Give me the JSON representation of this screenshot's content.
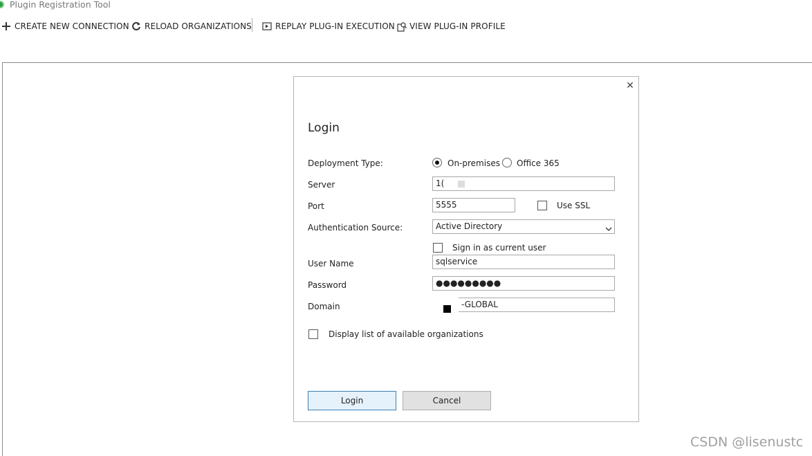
{
  "window": {
    "title": "Plugin Registration Tool"
  },
  "toolbar": {
    "create_connection": {
      "label": "CREATE NEW CONNECTION",
      "icon": "plus-icon"
    },
    "reload_orgs": {
      "label": "RELOAD ORGANIZATIONS",
      "icon": "refresh-icon"
    },
    "replay_execution": {
      "label": "REPLAY PLUG-IN EXECUTION",
      "icon": "play-box-icon"
    },
    "view_profile": {
      "label": "VIEW PLUG-IN PROFILE",
      "icon": "profile-search-icon"
    }
  },
  "dialog": {
    "title": "Login",
    "close_icon": "close-icon",
    "deployment_type": {
      "label": "Deployment Type:",
      "options": [
        "On-premises",
        "Office 365"
      ],
      "selected": "On-premises"
    },
    "server": {
      "label": "Server",
      "value": "1("
    },
    "port": {
      "label": "Port",
      "value": "5555"
    },
    "use_ssl": {
      "label": "Use SSL",
      "checked": false
    },
    "auth_source": {
      "label": "Authentication Source:",
      "value": "Active Directory"
    },
    "sign_in_current": {
      "label": "Sign in as current user",
      "checked": false
    },
    "username": {
      "label": "User Name",
      "value": "sqlservice"
    },
    "password": {
      "label": "Password",
      "value": "●●●●●●●●●"
    },
    "domain": {
      "label": "Domain",
      "value": "-GLOBAL"
    },
    "display_orgs": {
      "label": "Display list of available organizations",
      "checked": false
    },
    "login_button": "Login",
    "cancel_button": "Cancel"
  },
  "watermark": "CSDN @lisenustc",
  "colors": {
    "accent_border": "#3c7fb1",
    "accent_fill": "#e5f1fb",
    "logo": "#2e9e44"
  }
}
